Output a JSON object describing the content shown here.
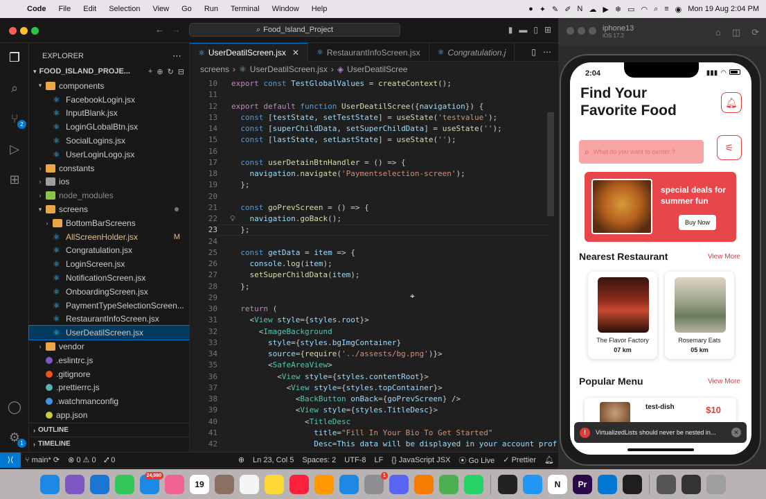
{
  "menubar": {
    "app": "Code",
    "items": [
      "File",
      "Edit",
      "Selection",
      "View",
      "Go",
      "Run",
      "Terminal",
      "Window",
      "Help"
    ],
    "datetime": "Mon 19 Aug  2:04 PM"
  },
  "window": {
    "search": "Food_Island_Project"
  },
  "explorer": {
    "title": "EXPLORER",
    "project": "FOOD_ISLAND_PROJE...",
    "rows": [
      {
        "label": "components",
        "depth": 1,
        "type": "folder",
        "open": true,
        "color": "#e8a848"
      },
      {
        "label": "FacebookLogin.jsx",
        "depth": 2,
        "type": "react"
      },
      {
        "label": "InputBlank.jsx",
        "depth": 2,
        "type": "react"
      },
      {
        "label": "LoginGLobalBtn.jsx",
        "depth": 2,
        "type": "react"
      },
      {
        "label": "SocialLogins.jsx",
        "depth": 2,
        "type": "react"
      },
      {
        "label": "UserLoginLogo.jsx",
        "depth": 2,
        "type": "react"
      },
      {
        "label": "constants",
        "depth": 1,
        "type": "folder",
        "open": false,
        "color": "#e8a848"
      },
      {
        "label": "ios",
        "depth": 1,
        "type": "folder",
        "open": false,
        "color": "#9e9e9e"
      },
      {
        "label": "node_modules",
        "depth": 1,
        "type": "folder",
        "open": false,
        "color": "#8bc34a",
        "dim": true
      },
      {
        "label": "screens",
        "depth": 1,
        "type": "folder",
        "open": true,
        "color": "#e8a848",
        "dot": true
      },
      {
        "label": "BottomBarScreens",
        "depth": 2,
        "type": "folder",
        "open": false,
        "color": "#e8a848"
      },
      {
        "label": "AllScreenHolder.jsx",
        "depth": 2,
        "type": "react",
        "modified": true,
        "flag": "M"
      },
      {
        "label": "Congratulation.jsx",
        "depth": 2,
        "type": "react"
      },
      {
        "label": "LoginScreen.jsx",
        "depth": 2,
        "type": "react"
      },
      {
        "label": "NotificationScreen.jsx",
        "depth": 2,
        "type": "react"
      },
      {
        "label": "OnboardingScreen.jsx",
        "depth": 2,
        "type": "react"
      },
      {
        "label": "PaymentTypeSelectionScreen...",
        "depth": 2,
        "type": "react"
      },
      {
        "label": "RestaurantInfoScreen.jsx",
        "depth": 2,
        "type": "react"
      },
      {
        "label": "UserDeatilScreen.jsx",
        "depth": 2,
        "type": "react",
        "selected": true
      },
      {
        "label": "vendor",
        "depth": 1,
        "type": "folder",
        "open": false,
        "color": "#e8a848"
      },
      {
        "label": ".eslintrc.js",
        "depth": 1,
        "type": "eslint"
      },
      {
        "label": ".gitignore",
        "depth": 1,
        "type": "git"
      },
      {
        "label": ".prettierrc.js",
        "depth": 1,
        "type": "prettier"
      },
      {
        "label": ".watchmanconfig",
        "depth": 1,
        "type": "watchman"
      },
      {
        "label": "app.json",
        "depth": 1,
        "type": "json"
      }
    ],
    "outline": "OUTLINE",
    "timeline": "TIMELINE"
  },
  "tabs": [
    {
      "label": "UserDeatilScreen.jsx",
      "active": true
    },
    {
      "label": "RestaurantInfoScreen.jsx",
      "active": false
    },
    {
      "label": "Congratulation.j",
      "active": false
    }
  ],
  "breadcrumb": [
    "screens",
    "UserDeatilScreen.jsx",
    "UserDeatilScree"
  ],
  "code": {
    "start": 10,
    "current": 23,
    "lines": [
      "export const TestGlobalValues = createContext();",
      "",
      "export default function UserDeatilScree({navigation}) {",
      "  const [testState, setTestState] = useState('testvalue');",
      "  const [superChildData, setSuperChildData] = useState('');",
      "  const [lastState, setLastState] = useState('');",
      "",
      "  const userDetainBtnHandler = () => {",
      "    navigation.navigate('Paymentselection-screen');",
      "  };",
      "",
      "  const goPrevScreen = () => {",
      "    navigation.goBack();",
      "  };",
      "",
      "  const getData = item => {",
      "    console.log(item);",
      "    setSuperChildData(item);",
      "  };",
      "",
      "  return (",
      "    <View style={styles.root}>",
      "      <ImageBackground",
      "        style={styles.bgImgContainer}",
      "        source={require('../assests/bg.png')}>",
      "        <SafeAreaView>",
      "          <View style={styles.contentRoot}>",
      "            <View style={styles.topContainer}>",
      "              <BackButton onBack={goPrevScreen} />",
      "              <View style={styles.TitleDesc}>",
      "                <TitleDesc",
      "                  title=\"Fill In Your Bio To Get Started\"",
      "                  Desc=\"This data will be displayed in your account prof"
    ]
  },
  "status": {
    "branch": "main*",
    "problems": "0",
    "warnings": "0",
    "ports": "0",
    "position": "Ln 23, Col 5",
    "spaces": "Spaces: 2",
    "encoding": "UTF-8",
    "eol": "LF",
    "language": "JavaScript JSX",
    "golive": "Go Live",
    "prettier": "Prettier"
  },
  "activity": {
    "badge_git": "2",
    "badge_settings": "1"
  },
  "simulator": {
    "device": "iphone13",
    "os": "iOS 17.2"
  },
  "phone": {
    "time": "2:04",
    "title": "Find Your Favorite Food",
    "search_placeholder": "What do you want to oerder ?",
    "banner": {
      "text": "special deals for summer fun",
      "button": "Buy Now"
    },
    "nearest": "Nearest Restaurant",
    "view_more": "View More",
    "restaurants": [
      {
        "name": "The Flavor Factory",
        "distance": "07 km"
      },
      {
        "name": "Rosemary Eats",
        "distance": "05 km"
      }
    ],
    "popular": "Popular Menu",
    "menu_item": "test-dish",
    "price": "$10",
    "toast": "VirtualizedLists should never be nested in..."
  },
  "dock": [
    {
      "name": "Finder",
      "color": "#1e88e5",
      "icon": "finder-icon"
    },
    {
      "name": "Launchpad",
      "color": "#7e57c2",
      "icon": "launchpad-icon"
    },
    {
      "name": "Safari",
      "color": "#1976d2",
      "icon": "safari-icon"
    },
    {
      "name": "Messages",
      "color": "#34c759",
      "icon": "messages-icon"
    },
    {
      "name": "Mail",
      "color": "#1e88e5",
      "icon": "mail-icon",
      "badge": "24,980"
    },
    {
      "name": "Photos",
      "color": "#f06292",
      "icon": "photos-icon"
    },
    {
      "name": "Calendar",
      "color": "#ffffff",
      "icon": "calendar-icon",
      "text": "19"
    },
    {
      "name": "Notes2",
      "color": "#8d6e63",
      "icon": "box-icon"
    },
    {
      "name": "Reminders",
      "color": "#f5f5f5",
      "icon": "reminders-icon"
    },
    {
      "name": "Notes",
      "color": "#fdd835",
      "icon": "notes-icon"
    },
    {
      "name": "Music",
      "color": "#fa233b",
      "icon": "music-icon"
    },
    {
      "name": "Pages",
      "color": "#ff9800",
      "icon": "pages-icon"
    },
    {
      "name": "App Store",
      "color": "#1e88e5",
      "icon": "appstore-icon"
    },
    {
      "name": "Settings",
      "color": "#8e8e93",
      "icon": "settings-icon",
      "badge": "1"
    },
    {
      "name": "Discord",
      "color": "#5865f2",
      "icon": "discord-icon"
    },
    {
      "name": "VLC",
      "color": "#f57c00",
      "icon": "vlc-icon"
    },
    {
      "name": "Chrome",
      "color": "#4caf50",
      "icon": "chrome-icon"
    },
    {
      "name": "WhatsApp",
      "color": "#25d366",
      "icon": "whatsapp-icon"
    },
    {
      "name": "Terminal",
      "color": "#222222",
      "icon": "terminal-icon"
    },
    {
      "name": "Xcode",
      "color": "#2196f3",
      "icon": "xcode-icon"
    },
    {
      "name": "Notion",
      "color": "#ffffff",
      "icon": "notion-icon",
      "text": "N"
    },
    {
      "name": "Premiere",
      "color": "#2a0a4a",
      "icon": "premiere-icon",
      "text": "Pr"
    },
    {
      "name": "VS Code",
      "color": "#0078d4",
      "icon": "vscode-icon"
    },
    {
      "name": "Figma",
      "color": "#1e1e1e",
      "icon": "figma-icon"
    },
    {
      "name": "Folder",
      "color": "#555555",
      "icon": "folder-icon"
    },
    {
      "name": "Desktop",
      "color": "#333333",
      "icon": "desktop-icon"
    },
    {
      "name": "Trash",
      "color": "#9e9e9e",
      "icon": "trash-icon"
    }
  ]
}
